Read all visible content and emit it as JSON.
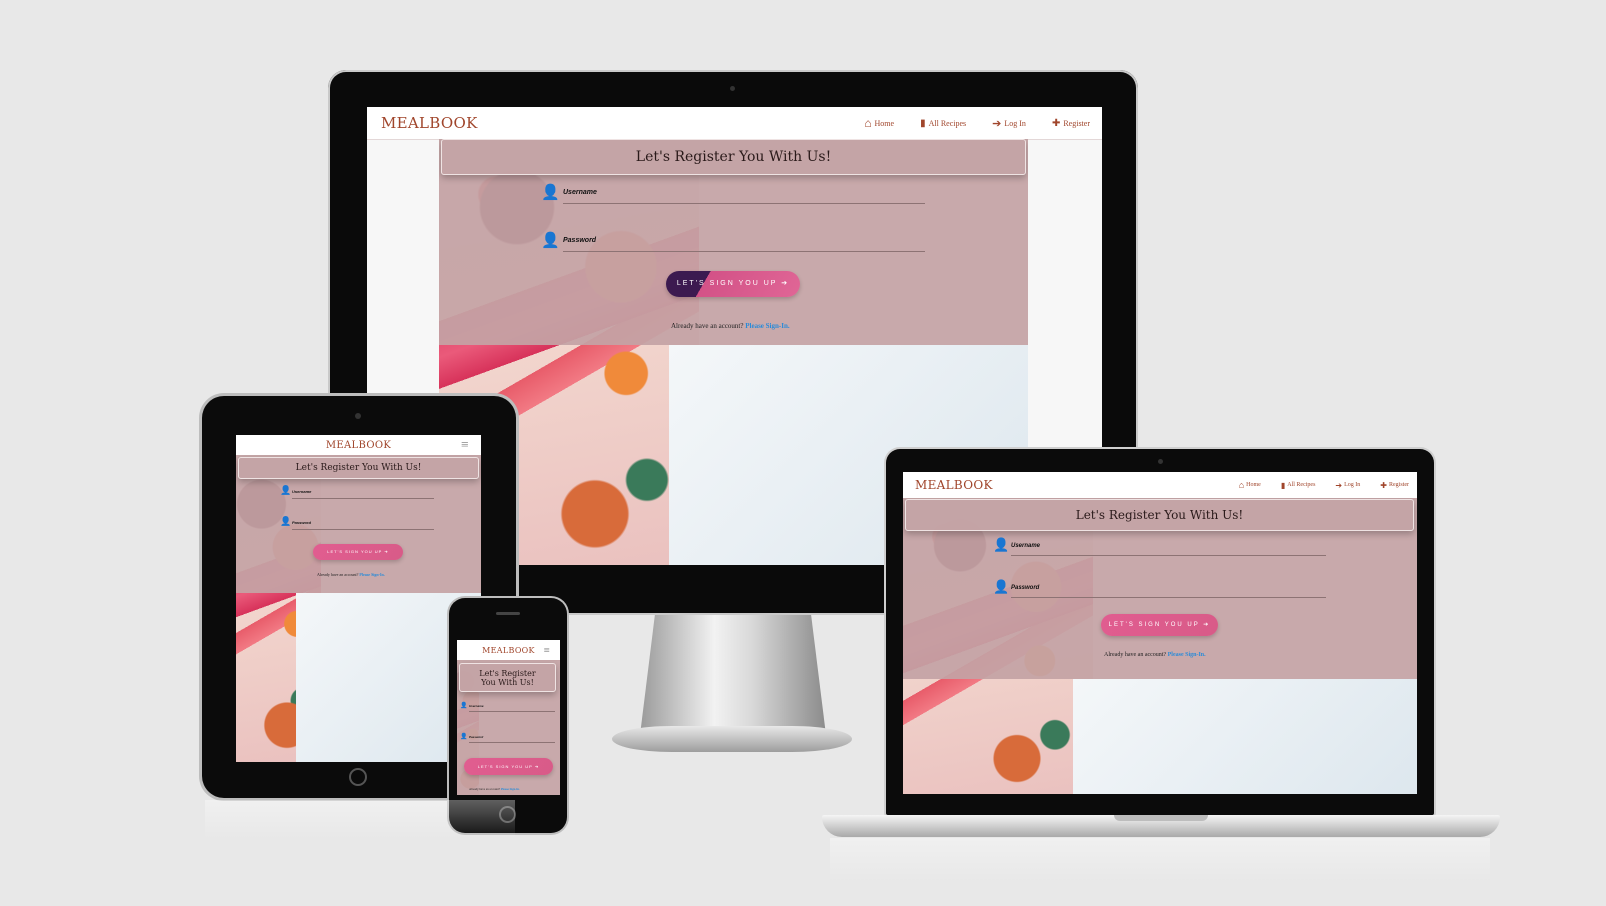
{
  "brand": "MEALBOOK",
  "nav": [
    {
      "icon": "home-icon",
      "glyph": "⌂",
      "label": "Home"
    },
    {
      "icon": "book-icon",
      "glyph": "▮",
      "label": "All Recipes"
    },
    {
      "icon": "login-icon",
      "glyph": "➔",
      "label": "Log In"
    },
    {
      "icon": "plus-square-icon",
      "glyph": "✚",
      "label": "Register"
    }
  ],
  "menu_glyph": "≡",
  "form": {
    "title": "Let's Register You With Us!",
    "title_mobile_line1": "Let's Register",
    "title_mobile_line2": "You With Us!",
    "username_label": "Username",
    "password_label": "Password",
    "submit_label": "LET'S SIGN YOU UP",
    "submit_glyph": "➔",
    "already_text": "Already have an account?",
    "signin_link": "Please Sign-In."
  },
  "colors": {
    "brand": "#a0452b",
    "panel": "#c4a3a5",
    "button": "#e15d90",
    "link": "#2a8bd8",
    "background": "#e8e8e8"
  }
}
